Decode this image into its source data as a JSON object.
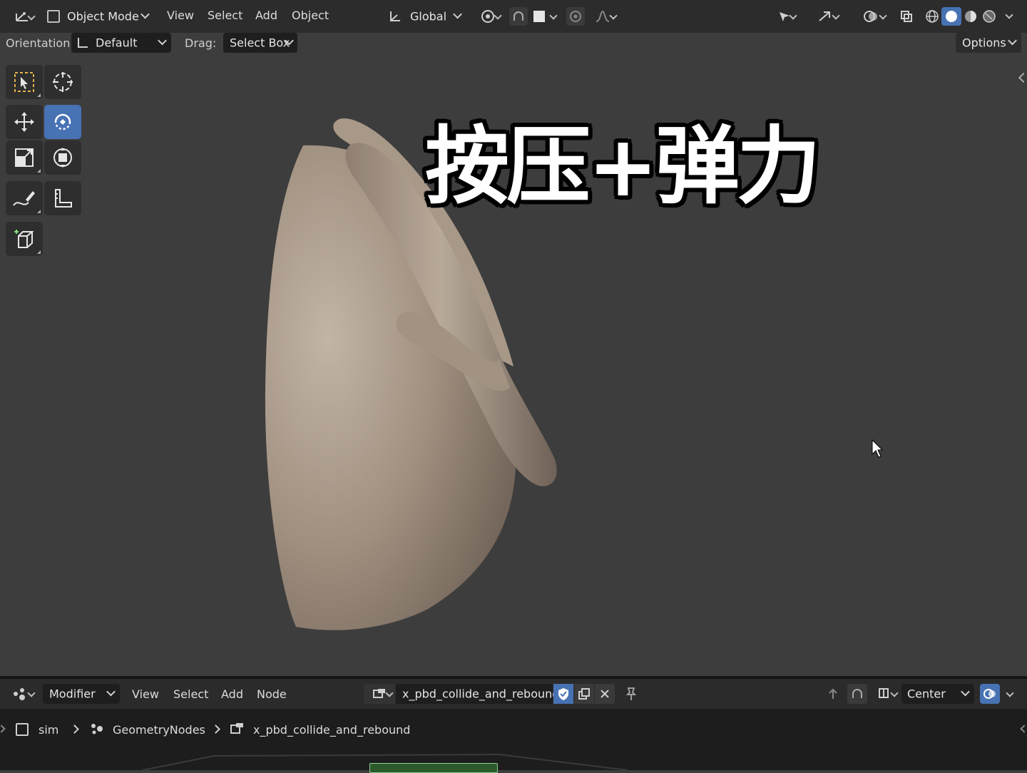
{
  "header": {
    "mode_label": "Object Mode",
    "menus": [
      "View",
      "Select",
      "Add",
      "Object"
    ],
    "transform_orientation": "Global"
  },
  "tool_settings": {
    "orientation_label": "Orientation:",
    "orientation_value": "Default",
    "drag_label": "Drag:",
    "drag_value": "Select Box",
    "options_label": "Options"
  },
  "viewport": {
    "overlay_caption": "按压+弹力",
    "toolbar_icons": [
      "select-box-icon",
      "cursor-icon",
      "move-icon",
      "rotate-icon",
      "scale-icon",
      "transform-icon",
      "annotate-icon",
      "measure-icon",
      "add-cube-icon"
    ],
    "active_tool": "rotate-icon"
  },
  "node_editor": {
    "context_value": "Modifier",
    "menus": [
      "View",
      "Select",
      "Add",
      "Node"
    ],
    "node_group_name": "x_pbd_collide_and_rebound",
    "pivot_value": "Center",
    "breadcrumb": [
      "sim",
      "GeometryNodes",
      "x_pbd_collide_and_rebound"
    ]
  },
  "colors": {
    "accent": "#4772b3",
    "header_bg": "#2c2c2c",
    "viewport_bg": "#3d3d3d",
    "mesh": "#9c8c7c"
  }
}
